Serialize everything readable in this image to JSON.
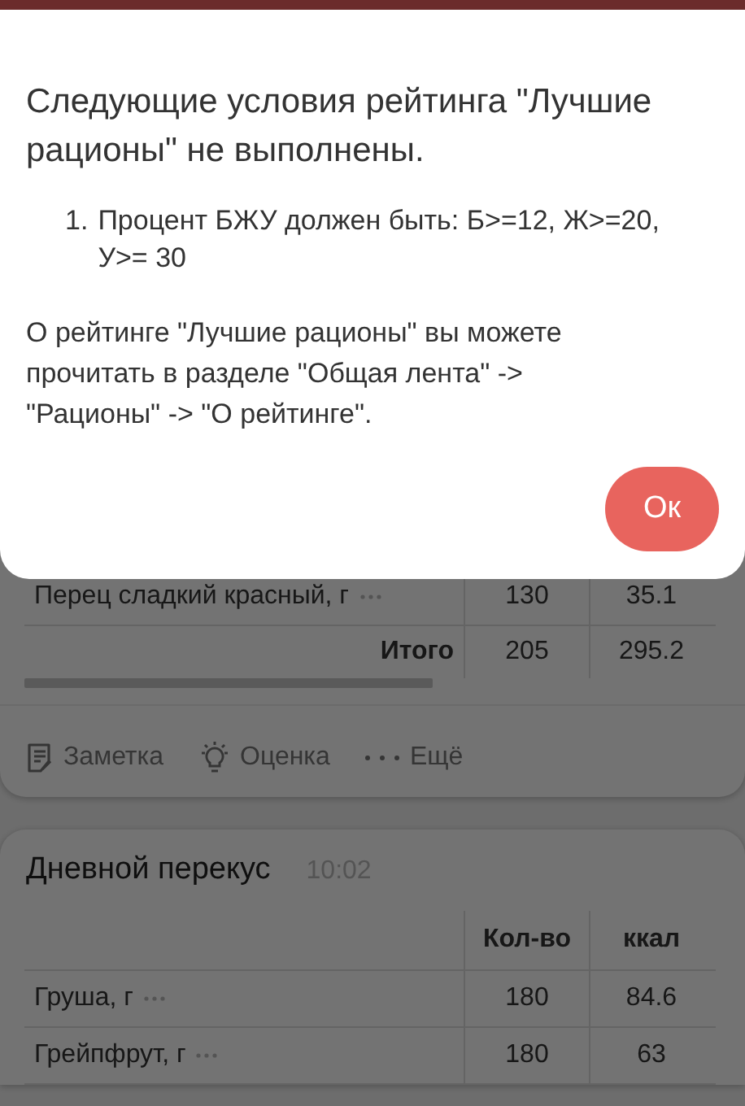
{
  "dialog": {
    "title": "Следующие условия рейтинга \"Лучшие рационы\" не выполнены.",
    "conditions": [
      {
        "number": "1.",
        "text": "Процент БЖУ должен быть: Б>=12, Ж>=20, У>= 30"
      }
    ],
    "note": "О рейтинге \"Лучшие рационы\" вы можете прочитать в разделе \"Общая лента\" -> \"Рационы\" -> \"О рейтинге\".",
    "button": "Ок"
  },
  "meals": [
    {
      "rows": [
        {
          "name": "Перец сладкий красный, г",
          "amount": "130",
          "kcal": "35.1"
        }
      ],
      "total": {
        "label": "Итого",
        "amount": "205",
        "kcal": "295.2"
      },
      "actions": [
        {
          "kind": "note",
          "label": "Заметка"
        },
        {
          "kind": "rating",
          "label": "Оценка"
        },
        {
          "kind": "more",
          "label": "Ещё"
        }
      ]
    },
    {
      "title": "Дневной перекус",
      "time": "10:02",
      "columns": [
        "Кол-во",
        "ккал"
      ],
      "rows": [
        {
          "name": "Груша, г",
          "amount": "180",
          "kcal": "84.6"
        },
        {
          "name": "Грейпфрут, г",
          "amount": "180",
          "kcal": "63"
        }
      ]
    }
  ]
}
